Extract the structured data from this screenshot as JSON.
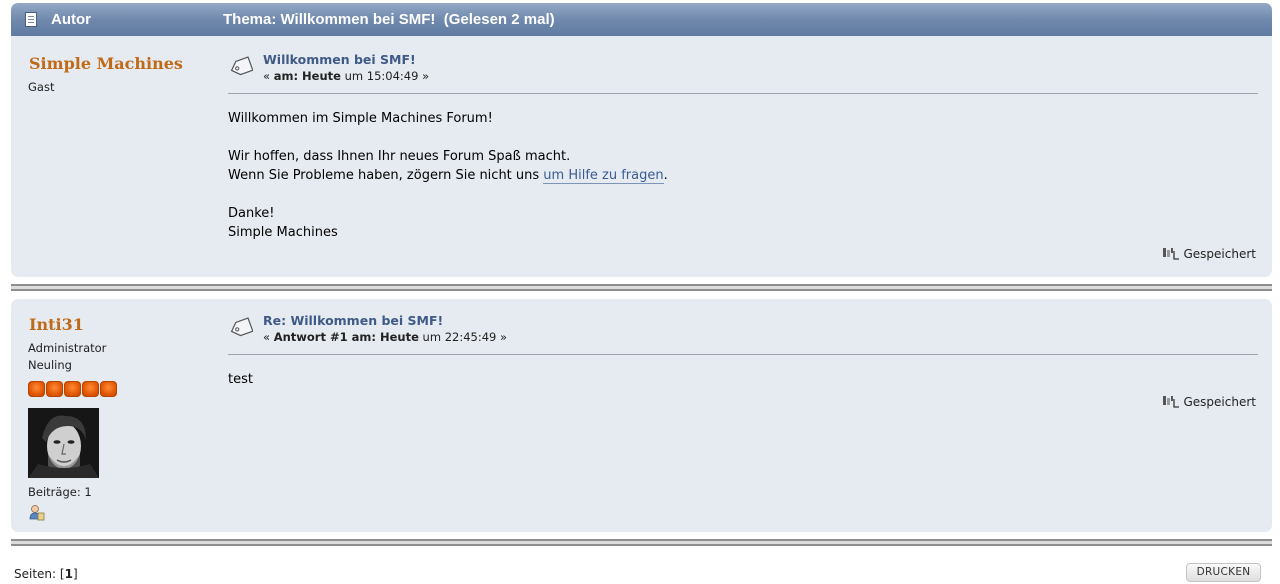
{
  "header": {
    "author_label": "Autor",
    "subject_label": "Thema: Willkommen bei SMF!  (Gelesen 2 mal)"
  },
  "posts": [
    {
      "poster_name": "Simple Machines",
      "member_group": "Gast",
      "title": "Willkommen bei SMF!",
      "date_prefix": "« ",
      "date_bold": "am: Heute",
      "date_rest": " um 15:04:49 »",
      "body_line1": "Willkommen im Simple Machines Forum!",
      "body_line2": "Wir hoffen, dass Ihnen Ihr neues Forum Spaß macht.",
      "body_line3_before": "Wenn Sie Probleme haben, zögern Sie nicht uns ",
      "body_link": "um Hilfe zu fragen",
      "body_line3_after": ".",
      "body_line4": "Danke!",
      "body_line5": "Simple Machines",
      "saved_label": "Gespeichert"
    },
    {
      "poster_name": "Inti31",
      "member_group": "Administrator",
      "post_group": "Neuling",
      "stars": 5,
      "post_count": "Beiträge: 1",
      "title": "Re: Willkommen bei SMF!",
      "date_prefix": "« ",
      "date_bold": "Antwort #1 am: Heute",
      "date_rest": " um 22:45:49 »",
      "body_line1": "test",
      "saved_label": "Gespeichert"
    }
  ],
  "footer": {
    "pages_label": "Seiten: [",
    "current_page": "1",
    "pages_close": "]",
    "print_label": "DRUCKEN"
  },
  "icons": {
    "header_icon": "document-icon",
    "message_icon": "message-icon",
    "saved_icon": "saved-icon",
    "profile_icon": "profile-icon"
  },
  "colors": {
    "header_bg": "#6f88ab",
    "post_bg": "#e6ebf2",
    "poster_name": "#c06a17",
    "title_link": "#3f5a86",
    "star": "#e35a05"
  }
}
